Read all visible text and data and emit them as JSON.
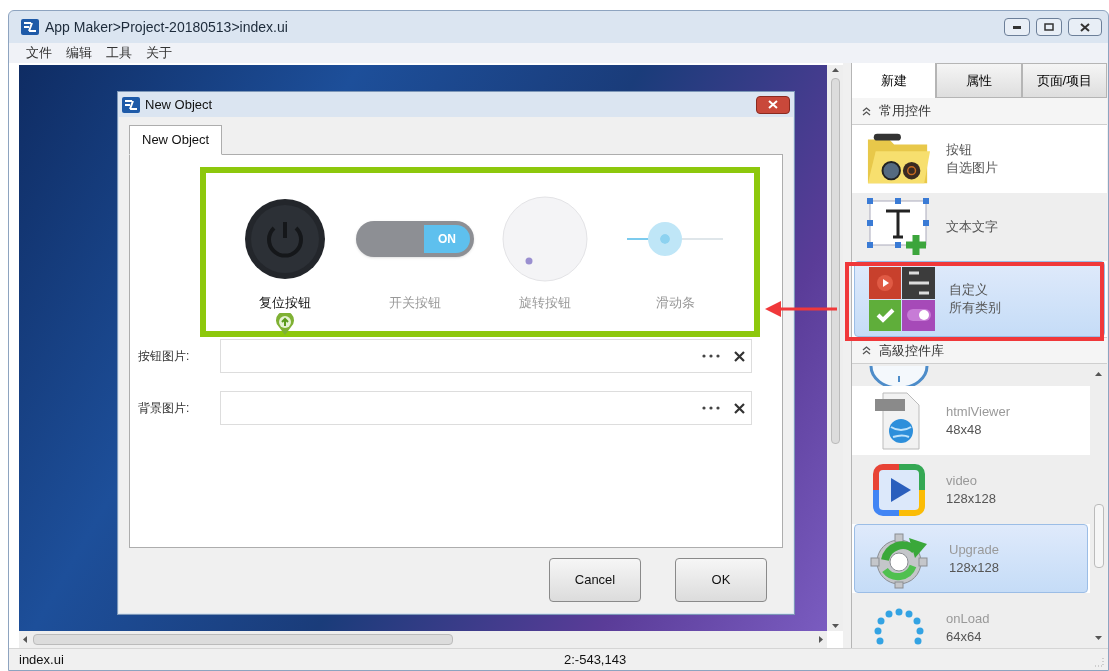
{
  "window": {
    "title": "App Maker>Project-20180513>index.ui"
  },
  "menu": [
    "文件",
    "编辑",
    "工具",
    "关于"
  ],
  "dialog": {
    "title": "New Object",
    "tabs": [
      {
        "label": "New Object",
        "selected": true
      }
    ],
    "widgets": [
      {
        "kind": "reset",
        "label": "复位按钮",
        "selected": true
      },
      {
        "kind": "switch",
        "label": "开关按钮",
        "selected": false,
        "on": true,
        "switch_text": "ON"
      },
      {
        "kind": "knob",
        "label": "旋转按钮",
        "selected": false
      },
      {
        "kind": "slider",
        "label": "滑动条",
        "selected": false,
        "level": 0.4
      }
    ],
    "fields": [
      {
        "label": "按钮图片:"
      },
      {
        "label": "背景图片:"
      }
    ],
    "buttons": [
      "Cancel",
      "OK"
    ]
  },
  "panel": {
    "tabs": [
      {
        "label": "新建",
        "selected": true
      },
      {
        "label": "属性",
        "selected": false
      },
      {
        "label": "页面/项目",
        "selected": false
      }
    ],
    "sections": [
      {
        "title": "常用控件",
        "expanded": true,
        "items": [
          {
            "kind": "folder",
            "lines": [
              "按钮",
              "自选图片"
            ],
            "selected": false
          },
          {
            "kind": "text",
            "lines": [
              "文本文字"
            ],
            "selected": false
          },
          {
            "kind": "custom",
            "lines": [
              "自定义",
              "所有类别"
            ],
            "selected": true
          }
        ]
      },
      {
        "title": "高級控件库",
        "expanded": true,
        "items": [
          {
            "kind": "clock",
            "selected": false
          },
          {
            "kind": "html",
            "lines": [
              "htmlViewer",
              "48x48"
            ],
            "selected": false
          },
          {
            "kind": "video",
            "lines": [
              "video",
              "128x128"
            ],
            "selected": false
          },
          {
            "kind": "gear",
            "lines": [
              "Upgrade",
              "128x128"
            ],
            "selected": true
          },
          {
            "kind": "loading",
            "lines": [
              "onLoad",
              "64x64"
            ],
            "selected": false
          }
        ]
      }
    ]
  },
  "status_bar": {
    "file": "index.ui",
    "position": "2:-543,143"
  }
}
